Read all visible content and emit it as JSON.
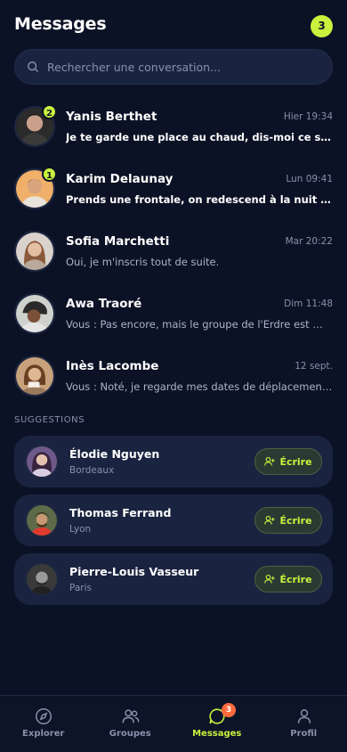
{
  "header": {
    "title": "Messages",
    "badge_count": "3"
  },
  "search": {
    "placeholder": "Rechercher une conversation..."
  },
  "conversations": [
    {
      "name": "Yanis Berthet",
      "time": "Hier 19:34",
      "preview": "Je te garde une place au chaud, dis-moi ce soir.",
      "unread": "2"
    },
    {
      "name": "Karim Delaunay",
      "time": "Lun 09:41",
      "preview": "Prends une frontale, on redescend à la nuit tombée.",
      "unread": "1"
    },
    {
      "name": "Sofia Marchetti",
      "time": "Mar 20:22",
      "preview": "Oui, je m'inscris tout de suite.",
      "unread": ""
    },
    {
      "name": "Awa Traoré",
      "time": "Dim 11:48",
      "preview": "Vous : Pas encore, mais le groupe de l'Erdre est …",
      "unread": ""
    },
    {
      "name": "Inès Lacombe",
      "time": "12 sept.",
      "preview": "Vous : Noté, je regarde mes dates de déplacement…",
      "unread": ""
    }
  ],
  "suggestions": {
    "title": "SUGGESTIONS",
    "items": [
      {
        "name": "Élodie Nguyen",
        "city": "Bordeaux",
        "button": "Écrire"
      },
      {
        "name": "Thomas Ferrand",
        "city": "Lyon",
        "button": "Écrire"
      },
      {
        "name": "Pierre-Louis Vasseur",
        "city": "Paris",
        "button": "Écrire"
      }
    ]
  },
  "tabs": [
    {
      "label": "Explorer",
      "icon": "compass-icon"
    },
    {
      "label": "Groupes",
      "icon": "users-icon"
    },
    {
      "label": "Messages",
      "icon": "chat-icon",
      "badge": "3"
    },
    {
      "label": "Profil",
      "icon": "user-icon"
    }
  ],
  "colors": {
    "background": "#0c1225",
    "accent": "#c9f23e",
    "card": "#1a2440",
    "badge_orange": "#ff6a3d"
  }
}
